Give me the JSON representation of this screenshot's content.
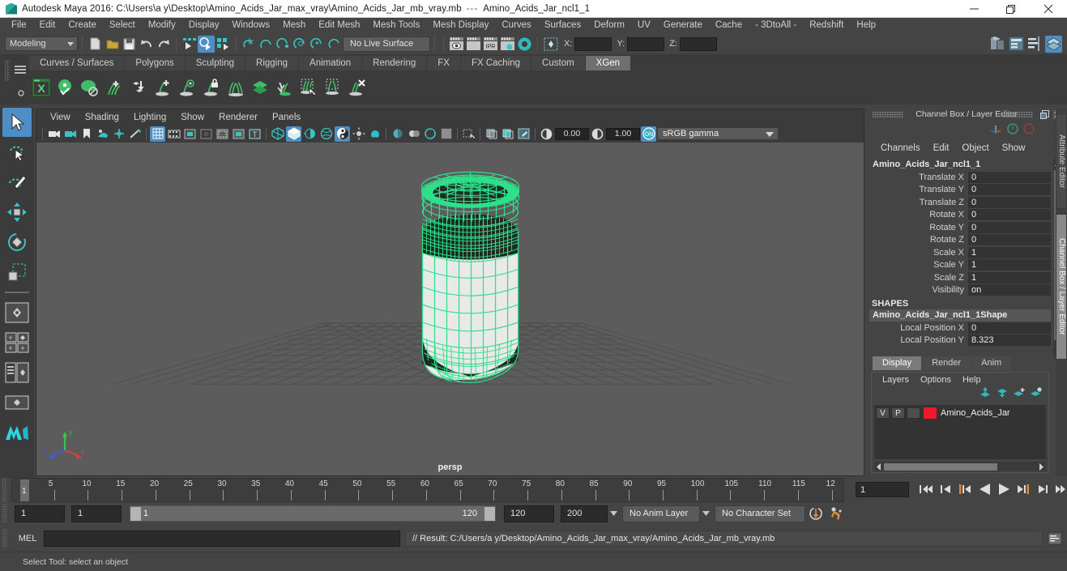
{
  "window": {
    "title": "Autodesk Maya 2016: C:\\Users\\a y\\Desktop\\Amino_Acids_Jar_max_vray\\Amino_Acids_Jar_mb_vray.mb",
    "title_separator": "---",
    "selected_object": "Amino_Acids_Jar_ncl1_1",
    "minimize": "minimize-icon",
    "maximize": "restore-icon",
    "close": "close-icon"
  },
  "menubar": {
    "items": [
      "File",
      "Edit",
      "Create",
      "Select",
      "Modify",
      "Display",
      "Windows",
      "Mesh",
      "Edit Mesh",
      "Mesh Tools",
      "Mesh Display",
      "Curves",
      "Surfaces",
      "Deform",
      "UV",
      "Generate",
      "Cache",
      "- 3DtoAll -",
      "Redshift",
      "Help"
    ]
  },
  "statusline": {
    "menuset": "Modeling",
    "live_surface": "No Live Surface",
    "x_label": "X:",
    "y_label": "Y:",
    "z_label": "Z:",
    "x_value": "",
    "y_value": "",
    "z_value": ""
  },
  "shelf": {
    "tabs": [
      "Curves / Surfaces",
      "Polygons",
      "Sculpting",
      "Rigging",
      "Animation",
      "Rendering",
      "FX",
      "FX Caching",
      "Custom",
      "XGen"
    ],
    "active_tab": "XGen",
    "icons": [
      "xgen-window-icon",
      "xgen-preview-icon",
      "xgen-no-preview-icon",
      "xgen-add-description-icon",
      "xgen-import-collection-icon",
      "xgen-add-guide-icon",
      "xgen-guide-visibility-icon",
      "xgen-lock-guide-icon",
      "xgen-mirror-guides-icon",
      "xgen-layers-icon",
      "xgen-sculpt-guide-icon",
      "xgen-select-guides-icon",
      "xgen-region-icon",
      "xgen-delete-guide-icon"
    ]
  },
  "toolbox": {
    "items": [
      {
        "name": "select-tool",
        "selected": true
      },
      {
        "name": "lasso-select-tool",
        "selected": false
      },
      {
        "name": "paint-select-tool",
        "selected": false
      },
      {
        "name": "move-tool",
        "selected": false
      },
      {
        "name": "rotate-tool",
        "selected": false
      },
      {
        "name": "scale-tool",
        "selected": false
      },
      {
        "name": "layout-four-view-icon",
        "selected": false
      },
      {
        "name": "layout-quad-icon",
        "selected": false
      },
      {
        "name": "layout-outliner-persp-icon",
        "selected": false
      },
      {
        "name": "layout-single-persp-icon",
        "selected": false
      },
      {
        "name": "maya-logo-icon",
        "selected": false
      }
    ]
  },
  "viewport": {
    "menus": [
      "View",
      "Shading",
      "Lighting",
      "Show",
      "Renderer",
      "Panels"
    ],
    "exposure": "0.00",
    "gamma": "1.00",
    "color_profile": "sRGB gamma",
    "camera_label": "persp",
    "axis_x": "x",
    "axis_y": "y",
    "axis_z": "z",
    "wireframe_color": "#2de08a",
    "background_color": "#5c5c5c"
  },
  "channelbox": {
    "panel_title": "Channel Box / Layer Editor",
    "menus": [
      "Channels",
      "Edit",
      "Object",
      "Show"
    ],
    "node_name": "Amino_Acids_Jar_ncl1_1",
    "attributes": [
      {
        "label": "Translate X",
        "value": "0"
      },
      {
        "label": "Translate Y",
        "value": "0"
      },
      {
        "label": "Translate Z",
        "value": "0"
      },
      {
        "label": "Rotate X",
        "value": "0"
      },
      {
        "label": "Rotate Y",
        "value": "0"
      },
      {
        "label": "Rotate Z",
        "value": "0"
      },
      {
        "label": "Scale X",
        "value": "1"
      },
      {
        "label": "Scale Y",
        "value": "1"
      },
      {
        "label": "Scale Z",
        "value": "1"
      },
      {
        "label": "Visibility",
        "value": "on"
      }
    ],
    "shapes_label": "SHAPES",
    "shape_name": "Amino_Acids_Jar_ncl1_1Shape",
    "shape_attributes": [
      {
        "label": "Local Position X",
        "value": "0"
      },
      {
        "label": "Local Position Y",
        "value": "8.323"
      }
    ]
  },
  "rightdock": {
    "tabs": [
      "Attribute Editor",
      "Channel Box / Layer Editor"
    ],
    "active_tab": "Channel Box / Layer Editor"
  },
  "layereditor": {
    "tabs": [
      "Display",
      "Render",
      "Anim"
    ],
    "active_tab": "Display",
    "menus": [
      "Layers",
      "Options",
      "Help"
    ],
    "tool_icons": [
      "move-layer-up-icon",
      "move-layer-down-icon",
      "new-layer-icon",
      "new-layer-from-selected-icon"
    ],
    "layers": [
      {
        "visibility": "V",
        "playback": "P",
        "type": "",
        "color": "#ee1a2b",
        "name": "Amino_Acids_Jar"
      }
    ]
  },
  "timeslider": {
    "ticks": [
      5,
      10,
      15,
      20,
      25,
      30,
      35,
      40,
      45,
      50,
      55,
      60,
      65,
      70,
      75,
      80,
      85,
      90,
      95,
      100,
      105,
      110,
      115
    ],
    "last_partial_label": "12",
    "current_frame_marker": "1",
    "current_frame_field": "1",
    "playback_buttons": [
      "go-to-start-icon",
      "step-back-keyframe-icon",
      "step-back-frame-icon",
      "play-backwards-icon",
      "play-forwards-icon",
      "step-forward-frame-icon",
      "step-forward-keyframe-icon",
      "go-to-end-icon"
    ]
  },
  "rangeslider": {
    "anim_start": "1",
    "range_start": "1",
    "bar_start_label": "1",
    "bar_end_label": "120",
    "range_end": "120",
    "anim_end": "200",
    "anim_layer": "No Anim Layer",
    "character_set": "No Character Set",
    "auto_key_icon": "auto-keyframe-icon",
    "anim_prefs_icon": "animation-preferences-icon"
  },
  "commandline": {
    "label": "MEL",
    "input_value": "",
    "result_text": "// Result: C:/Users/a y/Desktop/Amino_Acids_Jar_max_vray/Amino_Acids_Jar_mb_vray.mb",
    "script_editor_icon": "script-editor-icon"
  },
  "helpline": {
    "text": "Select Tool: select an object"
  }
}
